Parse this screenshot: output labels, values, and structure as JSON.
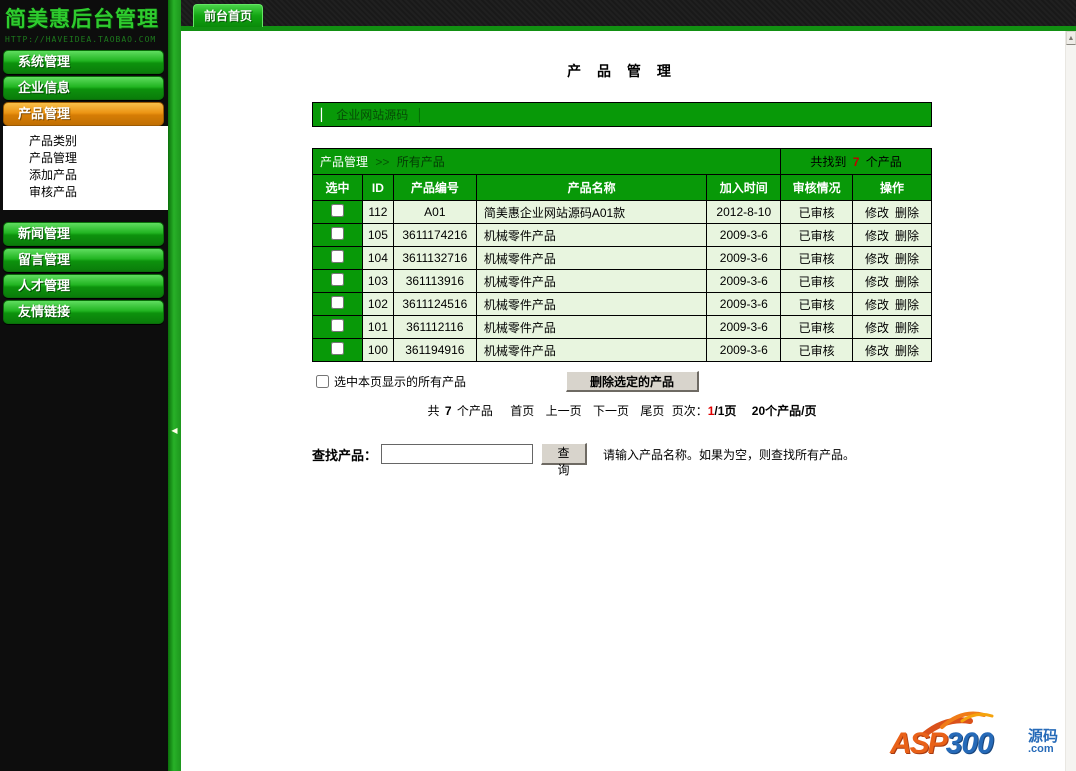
{
  "app": {
    "logo_title": "简美惠后台管理",
    "logo_url": "HTTP://HAVEIDEA.TAOBAO.COM"
  },
  "topbar": {
    "tab_label": "前台首页"
  },
  "sidebar": {
    "top_items": [
      {
        "label": "系统管理"
      },
      {
        "label": "企业信息"
      },
      {
        "label": "产品管理",
        "active": true
      }
    ],
    "submenu": [
      "产品类别",
      "产品管理",
      "添加产品",
      "审核产品"
    ],
    "bottom_items": [
      {
        "label": "新闻管理"
      },
      {
        "label": "留言管理"
      },
      {
        "label": "人才管理"
      },
      {
        "label": "友情链接"
      }
    ],
    "collapse_arrow": "◀"
  },
  "main": {
    "page_title": "产 品 管 理",
    "category_bar": {
      "left_mark": "▏",
      "link": "企业网站源码",
      "right_mark": "│"
    },
    "table": {
      "breadcrumb_root": "产品管理",
      "breadcrumb_sep": ">>",
      "breadcrumb_current": "所有产品",
      "found_prefix": "共找到",
      "found_count": "7",
      "found_suffix": "个产品",
      "columns": [
        "选中",
        "ID",
        "产品编号",
        "产品名称",
        "加入时间",
        "审核情况",
        "操作"
      ],
      "ops": {
        "edit": "修改",
        "delete": "删除"
      },
      "rows": [
        {
          "id": "112",
          "code": "A01",
          "name": "简美惠企业网站源码A01款",
          "date": "2012-8-10",
          "status": "已审核"
        },
        {
          "id": "105",
          "code": "3611174216",
          "name": "机械零件产品",
          "date": "2009-3-6",
          "status": "已审核"
        },
        {
          "id": "104",
          "code": "3611132716",
          "name": "机械零件产品",
          "date": "2009-3-6",
          "status": "已审核"
        },
        {
          "id": "103",
          "code": "361113916",
          "name": "机械零件产品",
          "date": "2009-3-6",
          "status": "已审核"
        },
        {
          "id": "102",
          "code": "3611124516",
          "name": "机械零件产品",
          "date": "2009-3-6",
          "status": "已审核"
        },
        {
          "id": "101",
          "code": "361112116",
          "name": "机械零件产品",
          "date": "2009-3-6",
          "status": "已审核"
        },
        {
          "id": "100",
          "code": "361194916",
          "name": "机械零件产品",
          "date": "2009-3-6",
          "status": "已审核"
        }
      ]
    },
    "controls": {
      "select_all_label": "选中本页显示的所有产品",
      "delete_button": "删除选定的产品"
    },
    "pagination": {
      "total_prefix": "共",
      "total_count": "7",
      "total_suffix": "个产品",
      "first": "首页",
      "prev": "上一页",
      "next": "下一页",
      "last": "尾页",
      "page_label": "页次：",
      "current_page": "1",
      "page_total": "/1页",
      "per_page": "20个产品/页"
    },
    "search": {
      "label": "查找产品：",
      "input_value": "",
      "button": "查 询",
      "hint": "请输入产品名称。如果为空，则查找所有产品。"
    }
  },
  "footer": {
    "logo": {
      "asp": "ASP",
      "num": "300",
      "cn": "源码",
      "com": ".com"
    }
  },
  "colors": {
    "accent_green": "#089908",
    "button_green": "#21b421",
    "active_orange": "#ec9413",
    "row_bg": "#e8f5df",
    "count_red": "#c00000",
    "sidebar_bg": "#0d0d0d",
    "topbar_bg": "#1d1d1d"
  }
}
